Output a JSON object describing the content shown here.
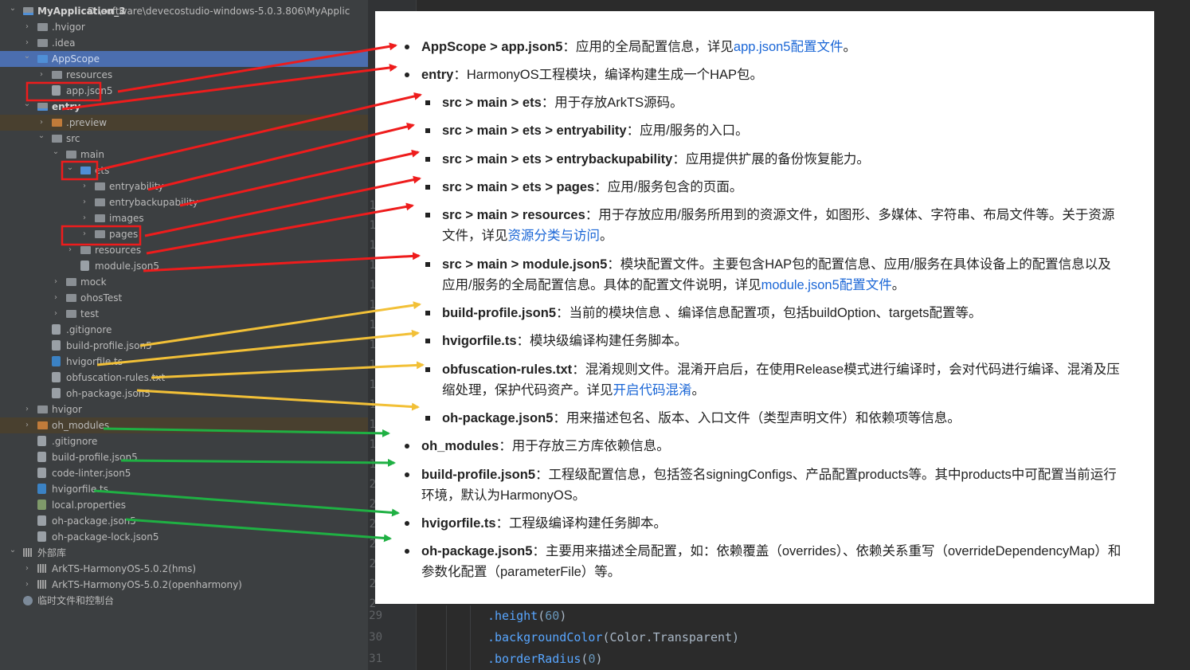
{
  "project_tree": [
    {
      "label": "MyApplication_3",
      "path": "D:\\software\\devecostudio-windows-5.0.3.806\\MyApplic",
      "icon": "module-folder-icon",
      "indent": 0,
      "expanded": true,
      "bold": true
    },
    {
      "label": ".hvigor",
      "icon": "folder-icon",
      "indent": 1,
      "expanded": false
    },
    {
      "label": ".idea",
      "icon": "folder-icon",
      "indent": 1,
      "expanded": false
    },
    {
      "label": "AppScope",
      "icon": "blue-folder-icon",
      "indent": 1,
      "expanded": true,
      "selected": true
    },
    {
      "label": "resources",
      "icon": "folder-icon",
      "indent": 2,
      "expanded": false
    },
    {
      "label": "app.json5",
      "icon": "json-file-icon",
      "indent": 2
    },
    {
      "label": "entry",
      "icon": "module-folder-icon",
      "indent": 1,
      "expanded": true,
      "bold": true
    },
    {
      "label": ".preview",
      "icon": "orange-folder-icon",
      "indent": 2,
      "expanded": false,
      "excluded": true
    },
    {
      "label": "src",
      "icon": "folder-icon",
      "indent": 2,
      "expanded": true
    },
    {
      "label": "main",
      "icon": "folder-icon",
      "indent": 3,
      "expanded": true
    },
    {
      "label": "ets",
      "icon": "blue-folder-icon",
      "indent": 4,
      "expanded": true
    },
    {
      "label": "entryability",
      "icon": "folder-icon",
      "indent": 5,
      "expanded": false
    },
    {
      "label": "entrybackupability",
      "icon": "folder-icon",
      "indent": 5,
      "expanded": false
    },
    {
      "label": "images",
      "icon": "folder-icon",
      "indent": 5,
      "expanded": false
    },
    {
      "label": "pages",
      "icon": "folder-icon",
      "indent": 5,
      "expanded": false
    },
    {
      "label": "resources",
      "icon": "folder-icon",
      "indent": 4,
      "expanded": false
    },
    {
      "label": "module.json5",
      "icon": "json-file-icon",
      "indent": 4
    },
    {
      "label": "mock",
      "icon": "folder-icon",
      "indent": 3,
      "expanded": false
    },
    {
      "label": "ohosTest",
      "icon": "folder-icon",
      "indent": 3,
      "expanded": false
    },
    {
      "label": "test",
      "icon": "folder-icon",
      "indent": 3,
      "expanded": false
    },
    {
      "label": ".gitignore",
      "icon": "file-icon",
      "indent": 2
    },
    {
      "label": "build-profile.json5",
      "icon": "json-file-icon",
      "indent": 2
    },
    {
      "label": "hvigorfile.ts",
      "icon": "ts-file-icon",
      "indent": 2
    },
    {
      "label": "obfuscation-rules.txt",
      "icon": "file-icon",
      "indent": 2
    },
    {
      "label": "oh-package.json5",
      "icon": "json-file-icon",
      "indent": 2
    },
    {
      "label": "hvigor",
      "icon": "folder-icon",
      "indent": 1,
      "expanded": false
    },
    {
      "label": "oh_modules",
      "icon": "orange-folder-icon",
      "indent": 1,
      "expanded": false,
      "excluded": true
    },
    {
      "label": ".gitignore",
      "icon": "file-icon",
      "indent": 1
    },
    {
      "label": "build-profile.json5",
      "icon": "json-file-icon",
      "indent": 1
    },
    {
      "label": "code-linter.json5",
      "icon": "json-file-icon",
      "indent": 1
    },
    {
      "label": "hvigorfile.ts",
      "icon": "ts-file-icon",
      "indent": 1
    },
    {
      "label": "local.properties",
      "icon": "properties-file-icon",
      "indent": 1
    },
    {
      "label": "oh-package.json5",
      "icon": "json-file-icon",
      "indent": 1
    },
    {
      "label": "oh-package-lock.json5",
      "icon": "json-file-icon",
      "indent": 1
    },
    {
      "label": "外部库",
      "icon": "library-icon",
      "indent": 0,
      "expanded": true
    },
    {
      "label": "ArkTS-HarmonyOS-5.0.2(hms)",
      "icon": "library-icon",
      "indent": 1,
      "expanded": false
    },
    {
      "label": "ArkTS-HarmonyOS-5.0.2(openharmony)",
      "icon": "library-icon",
      "indent": 1,
      "expanded": false
    },
    {
      "label": "临时文件和控制台",
      "icon": "scratch-icon",
      "indent": 0
    }
  ],
  "editor": {
    "lines": [
      {
        "num": "29",
        "method": ".height",
        "args": [
          {
            "text": "(",
            "type": "punct"
          },
          {
            "text": "60",
            "type": "num"
          },
          {
            "text": ")",
            "type": "punct"
          }
        ]
      },
      {
        "num": "30",
        "method": ".backgroundColor",
        "args": [
          {
            "text": "(Color.Transparent)",
            "type": "punct"
          }
        ]
      },
      {
        "num": "31",
        "method": ".borderRadius",
        "args": [
          {
            "text": "(",
            "type": "punct"
          },
          {
            "text": "0",
            "type": "num"
          },
          {
            "text": ")",
            "type": "punct"
          }
        ]
      }
    ],
    "gutter_fragments": [
      "1",
      "1",
      "1",
      "1",
      "1",
      "1",
      "1",
      "1",
      "1",
      "1",
      "1",
      "1",
      "1",
      "1",
      "2",
      "2",
      "2",
      "2",
      "2",
      "2",
      "2"
    ]
  },
  "description": {
    "items": [
      {
        "segments": [
          {
            "t": "AppScope > app.json5",
            "b": true
          },
          {
            "t": "：应用的全局配置信息，详见"
          },
          {
            "t": "app.json5配置文件",
            "link": true
          },
          {
            "t": "。"
          }
        ],
        "level": 1,
        "arrow": "red"
      },
      {
        "segments": [
          {
            "t": "entry",
            "b": true
          },
          {
            "t": "：HarmonyOS工程模块，编译构建生成一个HAP包。"
          }
        ],
        "level": 1,
        "arrow": "red"
      },
      {
        "segments": [
          {
            "t": "src > main > ets",
            "b": true
          },
          {
            "t": "：用于存放ArkTS源码。"
          }
        ],
        "level": 2,
        "arrow": "red"
      },
      {
        "segments": [
          {
            "t": "src > main > ets > entryability",
            "b": true
          },
          {
            "t": "：应用/服务的入口。"
          }
        ],
        "level": 2,
        "arrow": "red"
      },
      {
        "segments": [
          {
            "t": "src > main > ets > entrybackupability",
            "b": true
          },
          {
            "t": "：应用提供扩展的备份恢复能力。"
          }
        ],
        "level": 2,
        "arrow": "red"
      },
      {
        "segments": [
          {
            "t": "src > main > ets > pages",
            "b": true
          },
          {
            "t": "：应用/服务包含的页面。"
          }
        ],
        "level": 2,
        "arrow": "red"
      },
      {
        "segments": [
          {
            "t": "src > main > resources",
            "b": true
          },
          {
            "t": "：用于存放应用/服务所用到的资源文件，如图形、多媒体、字符串、布局文件等。关于资源文件，详见"
          },
          {
            "t": "资源分类与访问",
            "link": true
          },
          {
            "t": "。"
          }
        ],
        "level": 2,
        "arrow": "red"
      },
      {
        "segments": [
          {
            "t": "src > main > module.json5",
            "b": true
          },
          {
            "t": "：模块配置文件。主要包含HAP包的配置信息、应用/服务在具体设备上的配置信息以及应用/服务的全局配置信息。具体的配置文件说明，详见"
          },
          {
            "t": "module.json5配置文件",
            "link": true
          },
          {
            "t": "。"
          }
        ],
        "level": 2,
        "arrow": "red"
      },
      {
        "segments": [
          {
            "t": "build-profile.json5",
            "b": true
          },
          {
            "t": "：当前的模块信息 、编译信息配置项，包括buildOption、targets配置等。"
          }
        ],
        "level": 2,
        "arrow": "yellow"
      },
      {
        "segments": [
          {
            "t": "hvigorfile.ts",
            "b": true
          },
          {
            "t": "：模块级编译构建任务脚本。"
          }
        ],
        "level": 2,
        "arrow": "yellow"
      },
      {
        "segments": [
          {
            "t": "obfuscation-rules.txt",
            "b": true
          },
          {
            "t": "：混淆规则文件。混淆开启后，在使用Release模式进行编译时，会对代码进行编译、混淆及压缩处理，保护代码资产。详见"
          },
          {
            "t": "开启代码混淆",
            "link": true
          },
          {
            "t": "。"
          }
        ],
        "level": 2,
        "arrow": "yellow"
      },
      {
        "segments": [
          {
            "t": "oh-package.json5",
            "b": true
          },
          {
            "t": "：用来描述包名、版本、入口文件（类型声明文件）和依赖项等信息。"
          }
        ],
        "level": 2,
        "arrow": "yellow"
      },
      {
        "segments": [
          {
            "t": "oh_modules",
            "b": true
          },
          {
            "t": "：用于存放三方库依赖信息。"
          }
        ],
        "level": 1,
        "arrow": "green"
      },
      {
        "segments": [
          {
            "t": "build-profile.json5",
            "b": true
          },
          {
            "t": "：工程级配置信息，包括签名signingConfigs、产品配置products等。其中products中可配置当前运行环境，默认为HarmonyOS。"
          }
        ],
        "level": 1,
        "arrow": "green"
      },
      {
        "segments": [
          {
            "t": "hvigorfile.ts",
            "b": true
          },
          {
            "t": "：工程级编译构建任务脚本。"
          }
        ],
        "level": 1,
        "arrow": "green"
      },
      {
        "segments": [
          {
            "t": "oh-package.json5",
            "b": true
          },
          {
            "t": "：主要用来描述全局配置，如：依赖覆盖（overrides）、依赖关系重写（overrideDependencyMap）和参数化配置（parameterFile）等。"
          }
        ],
        "level": 1,
        "arrow": "green"
      }
    ]
  },
  "colors": {
    "arrow_red": "#ee1c1c",
    "arrow_yellow": "#f2c037",
    "arrow_green": "#1fb043",
    "link": "#1a66d6",
    "selection": "#4b6eaf"
  }
}
